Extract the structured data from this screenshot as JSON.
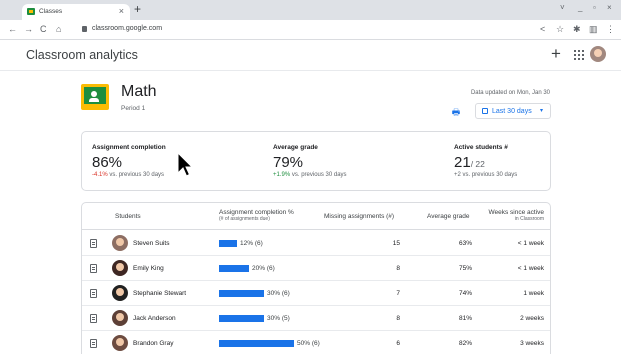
{
  "browser": {
    "tab_title": "Classes",
    "tab_close": "×",
    "new_tab": "+",
    "url": "classroom.google.com",
    "nav": {
      "back": "←",
      "forward": "→",
      "reload": "C",
      "home": "⌂"
    },
    "window_controls": {
      "dropdown": "˅",
      "minimize": "_",
      "maximize": "▫",
      "close": "×"
    },
    "toolbar": {
      "share": "<",
      "star": "☆",
      "extensions": "✱",
      "sidebar": "▥",
      "menu": "⋮"
    }
  },
  "app": {
    "title": "Classroom analytics",
    "add": "+"
  },
  "class": {
    "name": "Math",
    "period": "Period 1",
    "updated": "Data updated on Mon, Jan 30",
    "range_label": "Last 30 days",
    "range_arrow": "▾",
    "print": "🖶"
  },
  "summary": {
    "assignment": {
      "label": "Assignment completion",
      "value": "86%",
      "delta": "-4.1%",
      "delta_suffix": " vs. previous 30 days"
    },
    "grade": {
      "label": "Average grade",
      "value": "79%",
      "delta": "+1.9%",
      "delta_suffix": " vs. previous 30 days"
    },
    "students": {
      "label": "Active students",
      "label_suffix": "#",
      "value": "21",
      "total": "/ 22",
      "delta": "+2 vs. previous 30 days"
    }
  },
  "table": {
    "headers": {
      "students": "Students",
      "completion": "Assignment completion %",
      "completion_sub": "(# of assignments due)",
      "missing": "Missing assignments (#)",
      "grade": "Average grade",
      "weeks": "Weeks since active",
      "weeks_sub": "in Classroom"
    },
    "rows": [
      {
        "name": "Steven Suits",
        "completion": "12% (6)",
        "completion_pct": 12,
        "missing": "15",
        "grade": "63%",
        "weeks": "< 1 week",
        "avatar_color": "#8d6e63"
      },
      {
        "name": "Emily King",
        "completion": "20% (6)",
        "completion_pct": 20,
        "missing": "8",
        "grade": "75%",
        "weeks": "< 1 week",
        "avatar_color": "#3e2723"
      },
      {
        "name": "Stephanie Stewart",
        "completion": "30% (6)",
        "completion_pct": 30,
        "missing": "7",
        "grade": "74%",
        "weeks": "1 week",
        "avatar_color": "#212121"
      },
      {
        "name": "Jack Anderson",
        "completion": "30% (5)",
        "completion_pct": 30,
        "missing": "8",
        "grade": "81%",
        "weeks": "2 weeks",
        "avatar_color": "#5d4037"
      },
      {
        "name": "Brandon Gray",
        "completion": "50% (6)",
        "completion_pct": 50,
        "missing": "6",
        "grade": "82%",
        "weeks": "3 weeks",
        "avatar_color": "#6d4c41"
      }
    ]
  },
  "colors": {
    "accent": "#1a73e8",
    "negative": "#d93025",
    "positive": "#1e8e3e",
    "class_icon": "#fbbc04"
  }
}
